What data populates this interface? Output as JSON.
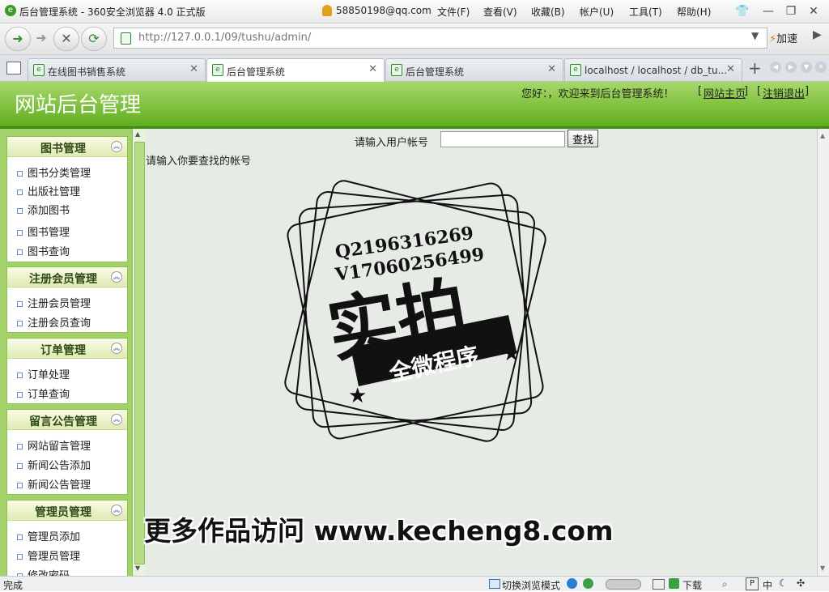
{
  "window": {
    "title": "后台管理系统 - 360安全浏览器 4.0 正式版",
    "user_email": "58850198@qq.com",
    "menus": [
      "文件(F)",
      "查看(V)",
      "收藏(B)",
      "帐户(U)",
      "工具(T)",
      "帮助(H)"
    ]
  },
  "nav": {
    "url": "http://127.0.0.1/09/tushu/admin/",
    "accelerate_label": "加速"
  },
  "tabs": [
    {
      "label": "在线图书销售系统",
      "active": false
    },
    {
      "label": "后台管理系统",
      "active": true
    },
    {
      "label": "后台管理系统",
      "active": false
    },
    {
      "label": "localhost / localhost / db_tu...",
      "active": false
    }
  ],
  "header": {
    "site_title": "网站后台管理",
    "welcome": "您好：，欢迎来到后台管理系统！",
    "home_link": "网站主页",
    "logout_link": "注销退出"
  },
  "sidebar": {
    "groups": [
      {
        "title": "图书管理",
        "items": [
          "图书分类管理",
          "出版社管理",
          "添加图书",
          "图书管理",
          "图书查询"
        ]
      },
      {
        "title": "注册会员管理",
        "items": [
          "注册会员管理",
          "注册会员查询"
        ]
      },
      {
        "title": "订单管理",
        "items": [
          "订单处理",
          "订单查询"
        ]
      },
      {
        "title": "留言公告管理",
        "items": [
          "网站留言管理",
          "新闻公告添加",
          "新闻公告管理"
        ]
      },
      {
        "title": "管理员管理",
        "items": [
          "管理员添加",
          "管理员管理",
          "修改密码"
        ]
      }
    ]
  },
  "main": {
    "search_label": "请输入用户帐号",
    "search_value": "",
    "search_button": "查找",
    "hint": "请输入你要查找的帐号"
  },
  "watermark": {
    "contact_line1": "Q2196316269",
    "contact_line2": "V17060256499",
    "stamp_main": "实拍",
    "stamp_sub": "全微程序",
    "footer": "更多作品访问 www.kecheng8.com"
  },
  "status": {
    "left": "完成",
    "mode": "切换浏览模式",
    "download": "下载",
    "ime": "中"
  },
  "colors": {
    "banner": "#6cb62a",
    "sidebar": "#a3d16a",
    "content": "#e6ece5"
  }
}
